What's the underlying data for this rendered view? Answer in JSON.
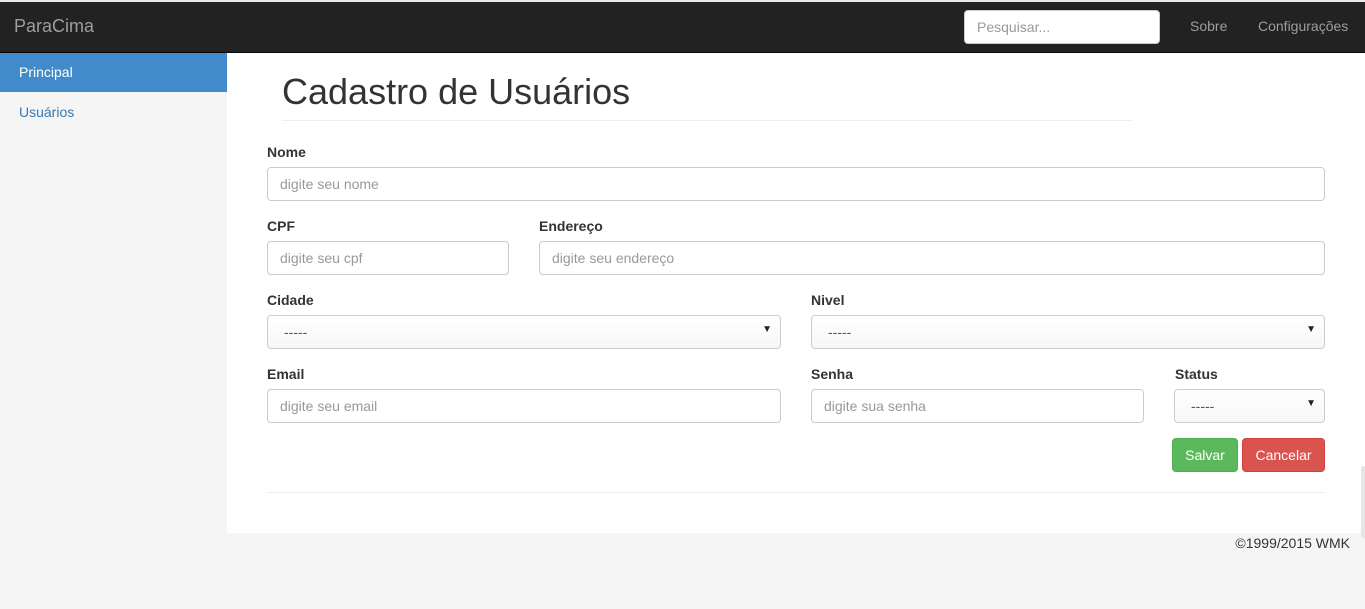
{
  "navbar": {
    "brand": "ParaCima",
    "search_placeholder": "Pesquisar...",
    "links": [
      "Sobre",
      "Configurações"
    ]
  },
  "sidebar": {
    "items": [
      {
        "label": "Principal",
        "active": true
      },
      {
        "label": "Usuários",
        "active": false
      }
    ]
  },
  "main": {
    "title": "Cadastro de Usuários"
  },
  "form": {
    "nome": {
      "label": "Nome",
      "placeholder": "digite seu nome"
    },
    "cpf": {
      "label": "CPF",
      "placeholder": "digite seu cpf"
    },
    "endereco": {
      "label": "Endereço",
      "placeholder": "digite seu endereço"
    },
    "cidade": {
      "label": "Cidade",
      "value": "-----"
    },
    "nivel": {
      "label": "Nivel",
      "value": "-----"
    },
    "email": {
      "label": "Email",
      "placeholder": "digite seu email"
    },
    "senha": {
      "label": "Senha",
      "placeholder": "digite sua senha"
    },
    "status": {
      "label": "Status",
      "value": "-----"
    },
    "save_label": "Salvar",
    "cancel_label": "Cancelar"
  },
  "footer": {
    "text": "©1999/2015 WMK"
  },
  "colors": {
    "navbar_bg": "#222222",
    "active_item": "#428bca",
    "link": "#337ab7",
    "save": "#5cb85c",
    "cancel": "#d9534f"
  }
}
